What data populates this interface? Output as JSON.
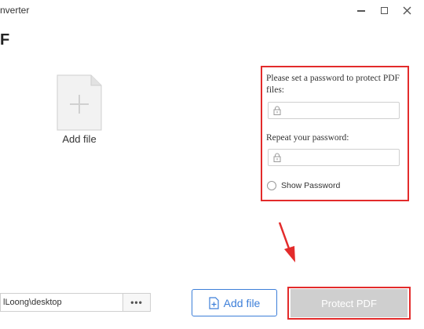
{
  "window": {
    "title": "nverter",
    "heading": "F"
  },
  "add_file_area": {
    "label": "Add file"
  },
  "password_panel": {
    "prompt": "Please set a password to protect PDF files:",
    "repeat_label": "Repeat your password:",
    "password_value": "",
    "repeat_value": "",
    "show_password_label": "Show Password",
    "show_password_checked": false
  },
  "footer": {
    "output_path": "lLoong\\desktop",
    "browse_label": "•••",
    "add_file_button": "Add file",
    "protect_button": "Protect PDF"
  },
  "colors": {
    "highlight_red": "#e32b2b",
    "accent_blue": "#3d7fd9",
    "disabled_gray": "#cfcfcf"
  }
}
